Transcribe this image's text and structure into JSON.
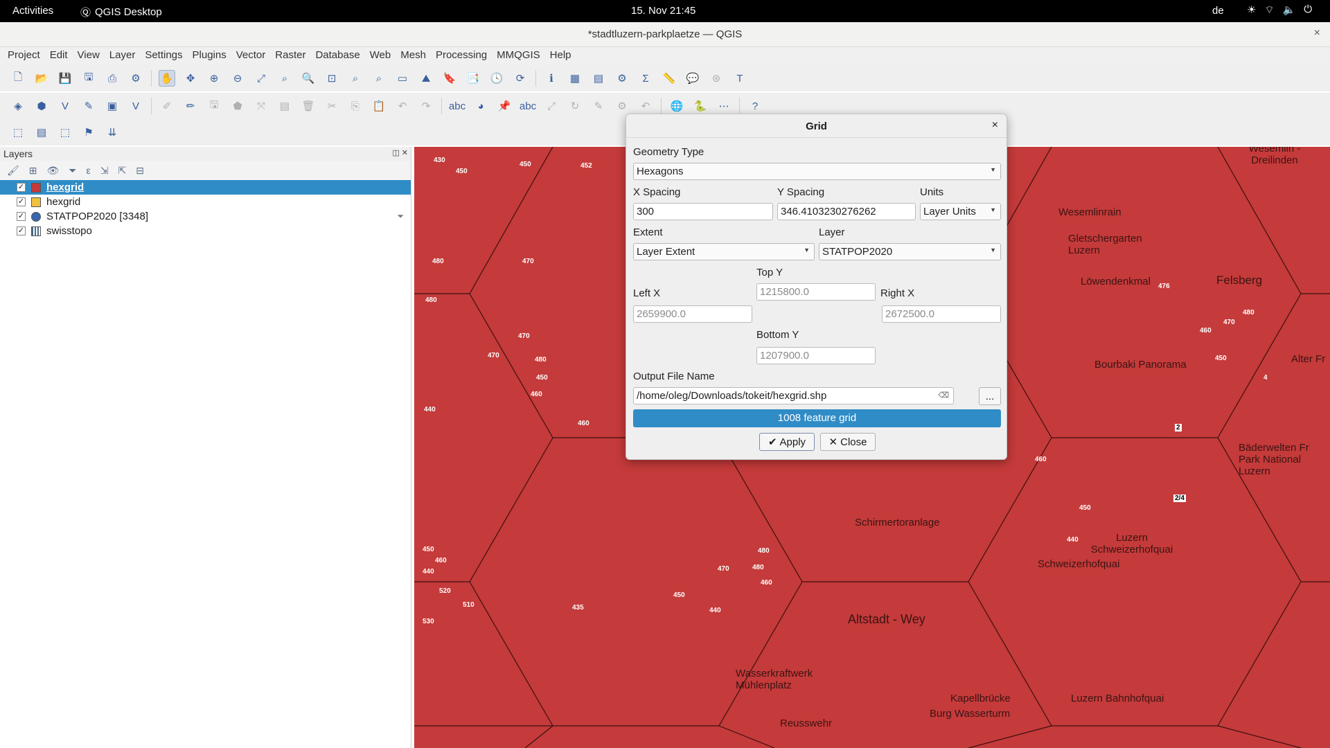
{
  "topbar": {
    "activities": "Activities",
    "app": "QGIS Desktop",
    "clock": "15. Nov  21:45",
    "lang": "de",
    "tray": [
      "☀",
      "⌔",
      "🔈",
      "⏻"
    ]
  },
  "window": {
    "title": "*stadtluzern-parkplaetze — QGIS",
    "close": "×"
  },
  "menu": [
    "Project",
    "Edit",
    "View",
    "Layer",
    "Settings",
    "Plugins",
    "Vector",
    "Raster",
    "Database",
    "Web",
    "Mesh",
    "Processing",
    "MMQGIS",
    "Help"
  ],
  "layers_panel": {
    "title": "Layers",
    "buttons": "◫ ✕",
    "layers": [
      {
        "name": "hexgrid",
        "checked": "✓",
        "symbol_color": "#c53a3a",
        "selected": true
      },
      {
        "name": "hexgrid",
        "checked": "✓",
        "symbol_color": "#f0c040"
      },
      {
        "name": "STATPOP2020 [3348]",
        "checked": "✓",
        "symbol_color": "#3a66b0",
        "filter": "⏷"
      },
      {
        "name": "swisstopo",
        "checked": "✓",
        "symbol_color": "#4a6a8a"
      }
    ]
  },
  "map_labels": [
    "Wesemlin - Dreilinden",
    "Wesemlinrain",
    "Gletschergarten Luzern",
    "Löwendenkmal",
    "Felsberg",
    "Bourbaki Panorama",
    "Alter Fr",
    "Bäderwelten Fr Park National Luzern",
    "Schirmertoranlage",
    "Luzern Schweizerhofquai",
    "Schweizerhofquai",
    "Altstadt - Wey",
    "Wasserkraftwerk Mühlenplatz",
    "Reusswehr",
    "Kapellbrücke",
    "Burg Wasserturm",
    "Luzern Bahnhofquai"
  ],
  "map_numbers": [
    "430",
    "450",
    "450",
    "452",
    "480",
    "470",
    "470",
    "480",
    "450",
    "470",
    "460",
    "440",
    "480",
    "480",
    "460",
    "450",
    "460",
    "440",
    "520",
    "510",
    "435",
    "530",
    "480",
    "480",
    "470",
    "450",
    "460",
    "440",
    "460",
    "450",
    "440",
    "476",
    "460",
    "470",
    "480",
    "450",
    "4",
    "2",
    "2/4"
  ],
  "dialog": {
    "title": "Grid",
    "close": "×",
    "geometry_type_label": "Geometry Type",
    "geometry_type": "Hexagons",
    "x_spacing_label": "X Spacing",
    "x_spacing": "300",
    "y_spacing_label": "Y Spacing",
    "y_spacing": "346.4103230276262",
    "units_label": "Units",
    "units": "Layer Units",
    "extent_label": "Extent",
    "extent": "Layer Extent",
    "layer_label": "Layer",
    "layer": "STATPOP2020",
    "top_y_label": "Top Y",
    "top_y": "1215800.0",
    "left_x_label": "Left X",
    "left_x": "2659900.0",
    "right_x_label": "Right X",
    "right_x": "2672500.0",
    "bottom_y_label": "Bottom Y",
    "bottom_y": "1207900.0",
    "output_label": "Output File Name",
    "output": "/home/oleg/Downloads/tokeit/hexgrid.shp",
    "browse": "...",
    "progress": "1008 feature grid",
    "progress_value": 1.0,
    "apply": "Apply",
    "apply_icon": "✔",
    "close_btn": "Close",
    "close_icon": "✕"
  },
  "colors": {
    "map_fill": "#c53a3a",
    "selection": "#308cc6"
  }
}
